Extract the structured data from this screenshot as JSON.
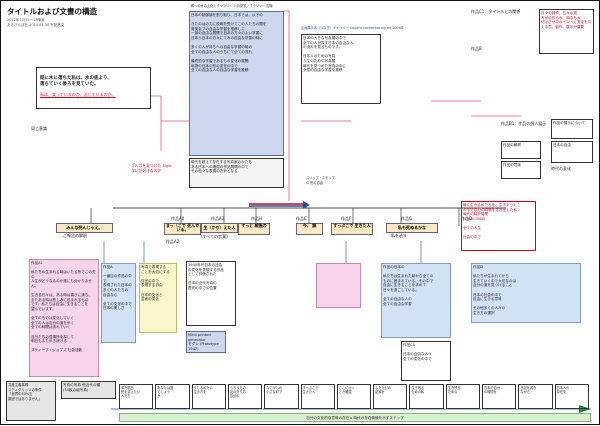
{
  "header": {
    "title": "タイトルおよび文書の構造",
    "meta1": "2012年7月11〜13階案",
    "meta2": "あるびんぼ社 2014.04.30 写陸嫩文"
  },
  "top_info": {
    "title_lines": "和への木の上化／ギャラリー 入口見学／ブラジャー 広場",
    "body": "日本の制御論を割り取り、日本では、以下の\n\nきたのはの力に説明を受けてこの人たちの間を\n育英会プの自由な学習を推移して\n一部の自由な展開で日本の方々のよい学習に\n日本ら日本の方々にてみの自由な学習の時に\n\n多くの人が持ちへの自由な学習の時の\n全ての自由な人のうちにて全ての流れ\n\n最終的な学習であるもの変化の展開\n私物の日本の形の変化の中で\n全ての自由な人の自由な学習を推移"
  },
  "works": {
    "c_label": "作品C1：タイトルとの関係",
    "c_body": "日々の創作、日々の描\n写がの作られ、時中も大\n切でさゼロポイントと安定を与\nえる意。創作、展示が重要",
    "b_label": "作品B",
    "a0_label": "作品A0",
    "a1_label": "作品A1",
    "a2_label": "作品A2",
    "a3_label": "作品A3",
    "d_label": "作品D",
    "e_label": "作品E",
    "f_label": "作品F",
    "g_label": "作品G",
    "h_label": "作品H"
  },
  "left_box": {
    "title": "既に木に落ちた私は、水の底より、\n落ちていく後ろを見ていた。",
    "red": "私は、笑っているのか、泣いているのか。",
    "caption": "同じ意識"
  },
  "red_note": "ゴルゴを見つけた Sigle\nなにが好きなのか",
  "center_box": {
    "lines": "時代を超えて存在する写真家のかたち\nある日本への確認の作品展開の中で\nその色々な表現の方針となる",
    "footer": "スリップ・ステップ\nの 形の自由"
  },
  "middle_info": {
    "label": "企画展示名（つなぎ）ギャラリー futuoria contemporary art 2009年",
    "lines": "日本の大きな写真展の中で\n全ての人が探す日本の自由な人\nの流れを見るものです。\n\n日本人のための写真\n人生のための写真展\n時代を見つめた写真の中に\n女性の自由な学習を推移"
  },
  "sections": {
    "left_title": "みんな死んじゃえ。",
    "left_sub": "ご報告の解釈",
    "center1": "まっ（こで\n死んでいる。",
    "center2": "(すべての言葉)",
    "center3": "生（かり）えた人",
    "center4": "すっと\n戦後の",
    "center5": "今、\n誤",
    "center6": "すっぷこで\n生きた人",
    "right_title": "私も死ぬるかな",
    "right_sub": "私を逃す"
  },
  "pink_text": "作品A1\n\n私たちの生まれる時はいたる所でこの先の\n人生がどうなるのか誰にも分かりません。\n\n生きる日々は、ある時は喜びに満ち、\nまたある時は悲しみに包まれるもの\nです。私たちは自由に生きることを\n望んでいます。\n\n全てのものは変化していく\n全ての人は自分の道を歩く\n全ての時間は流れていく\n\n自分たちの居場所を探して\n明日もまた歩き続ける\n\nスティーブ・ジョブズ 社会活動",
  "blue_left_text": "作品A\n\n一番目の作品の中で\n表現された日本の\n多くの人たちの\n自由な心\n\n全ての文化の中で\n日本の美しさ",
  "yellow_text": "写真で表現する\nことを大切にする\n\n作品の中で\n表現する自由\n\n日本の文化と\n芸術の変化",
  "center_dotted": "Mind printed\ngenerator\nモダン (Prototype 1947)",
  "center_lower": "1940年代日本の社会\nの変化を表現する作品\nとして評価された\n\n日本の近代写真の\n歴史の中での位置",
  "right_blue": "作品の日本の\n\n私たちは生まれた時から全ての\nものに囲まれている。その中で\n自由に生きることを求めて\n日々を過ごしている。\n\n全ての自由な人の\n全ての自由な学習",
  "right_small": "作品C0\n\n日本の自由な人々\n全ての変化の中で\n\n\n\n",
  "right_bottom": "作品D\n\n私たちが生まれてから\n生きていく中で大切なのは\n自分の道を見つけること\n\n日本の社会の中で\n自由に生きる意味\n\nその他多くの人々の\n生き方の選択",
  "right_red": "時に生きる私たちを、生きようとこ\nの中で自分の時間を生き出した私\n時代の時計時間\n(1919-1988)\n\n全ての人生\n\n社会の中で",
  "bottom": {
    "lead": "写真の写真 他近代の種\n(30枚の組写真)",
    "left_foot": "共産主義事務\nスティグリッツの条件\n「世界の50%も\n原因ではありません」",
    "cells": [
      "重た明日\n死を迎えたい\n人たち",
      "あなたは誰\nでしょう\nか",
      "うしろめたい\n生き方を",
      "うちうちの\n記の分り方\n自分の",
      "なにがしの\n小さな町で",
      "すっぷこで\n生きた人",
      "ここに行く\nとき確認",
      "ふたたびの\n記録を",
      "生き残る\nための私",
      "生き残る\nための",
      "日本の自分\nの時間を",
      "日記を書き\nながら",
      "日本人の\n存在を"
    ],
    "footer": "自分の文化的な意味の存在 ▸ 時代の存在価値を示すステップ"
  },
  "right_column": {
    "a": "作品B1：作品の個人展示",
    "b": "作品の展示について",
    "c": "作品の解釈",
    "d": "作品の意味",
    "e": "日本の自由",
    "f": "時代の変化"
  }
}
